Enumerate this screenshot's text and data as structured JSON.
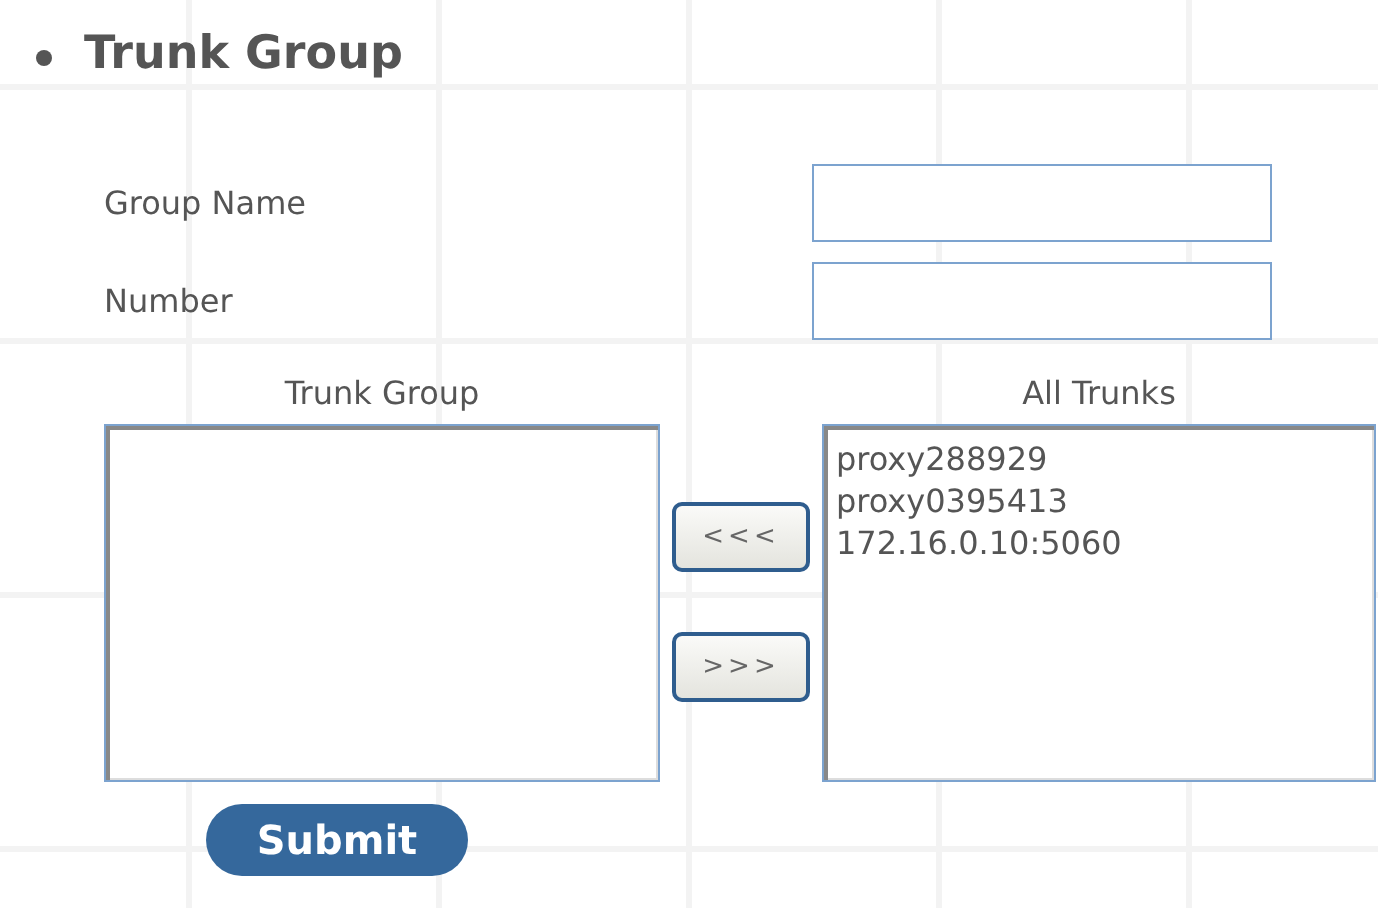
{
  "section": {
    "title": "Trunk Group"
  },
  "fields": [
    {
      "label": "Group Name"
    },
    {
      "label": "Number"
    }
  ],
  "trunk_group": {
    "heading": "Trunk Group"
  },
  "all_trunks": {
    "heading": "All Trunks",
    "items": [
      {
        "label": "proxy288929",
        "selected": false
      },
      {
        "label": "proxy0395413",
        "selected": false
      },
      {
        "label": "172.16.0.10:5060",
        "selected": false
      }
    ]
  },
  "move_buttons": [
    "<<<",
    ">>>"
  ],
  "submit": "Submit"
}
